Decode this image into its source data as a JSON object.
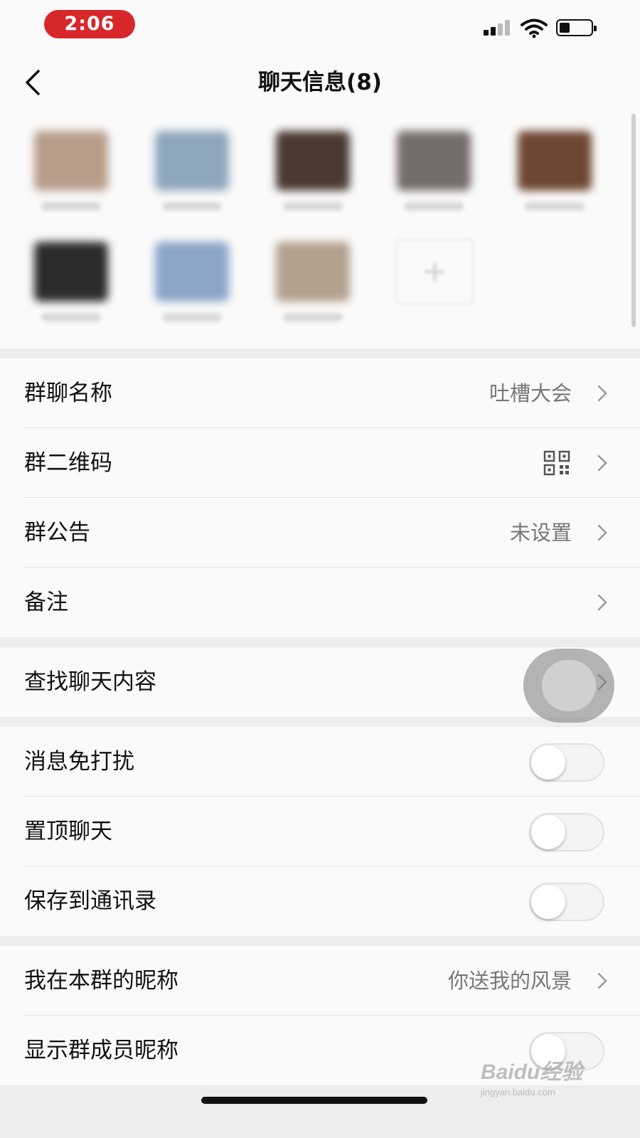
{
  "status_bar": {
    "time": "2:06"
  },
  "nav": {
    "title": "聊天信息(8)",
    "back_icon": "chevron-left-icon"
  },
  "members": {
    "avatar_colors": [
      "#b79d8a",
      "#8ea6bb",
      "#4a3a34",
      "#756c6a",
      "#6e4732",
      "#2c2c2c",
      "#8aa5c8",
      "#b4a08e"
    ],
    "add_button_icon": "plus-icon"
  },
  "group_info": {
    "group_name": {
      "label": "群聊名称",
      "value": "吐槽大会"
    },
    "qr_code": {
      "label": "群二维码",
      "icon": "qr-code-icon"
    },
    "announcement": {
      "label": "群公告",
      "value": "未设置"
    },
    "remark": {
      "label": "备注"
    }
  },
  "search": {
    "label": "查找聊天内容"
  },
  "settings": {
    "mute": {
      "label": "消息免打扰",
      "on": false
    },
    "pin": {
      "label": "置顶聊天",
      "on": false
    },
    "save_contacts": {
      "label": "保存到通讯录",
      "on": false
    }
  },
  "nickname": {
    "my_nickname": {
      "label": "我在本群的昵称",
      "value": "你送我的风景"
    },
    "show_nicknames": {
      "label": "显示群成员昵称",
      "on": false
    }
  },
  "watermark": {
    "main": "Baidu经验",
    "sub": "jingyan.baidu.com"
  }
}
